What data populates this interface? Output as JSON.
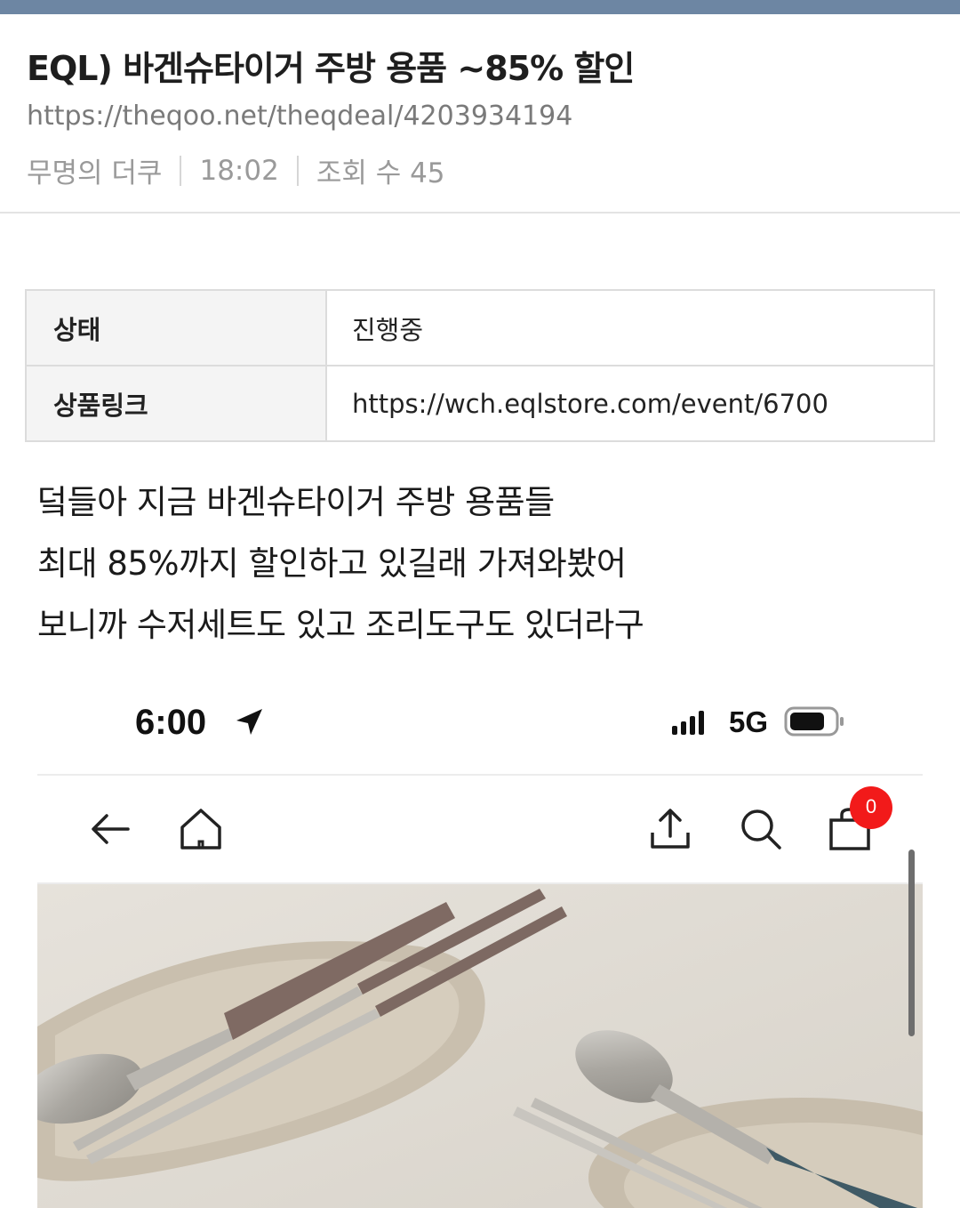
{
  "post": {
    "title": "EQL) 바겐슈타이거 주방 용품 ~85% 할인",
    "url": "https://theqoo.net/theqdeal/4203934194",
    "author": "무명의 더쿠",
    "time": "18:02",
    "views": "조회 수 45"
  },
  "info": [
    {
      "label": "상태",
      "value": "진행중"
    },
    {
      "label": "상품링크",
      "value": "https://wch.eqlstore.com/event/6700"
    }
  ],
  "body_lines": [
    "덬들아 지금 바겐슈타이거 주방 용품들",
    "최대 85%까지 할인하고 있길래 가져와봤어",
    "보니까 수저세트도 있고 조리도구도 있더라구"
  ],
  "phone": {
    "time": "6:00",
    "network": "5G",
    "cart_count": "0",
    "icons": [
      "location-arrow-icon",
      "signal-icon",
      "battery-icon",
      "back-arrow-icon",
      "home-icon",
      "share-icon",
      "search-icon",
      "shopping-bag-icon"
    ]
  },
  "colors": {
    "topbar": "#6d86a3",
    "badge": "#f21a1a",
    "meta_text": "#9a9a9a"
  }
}
